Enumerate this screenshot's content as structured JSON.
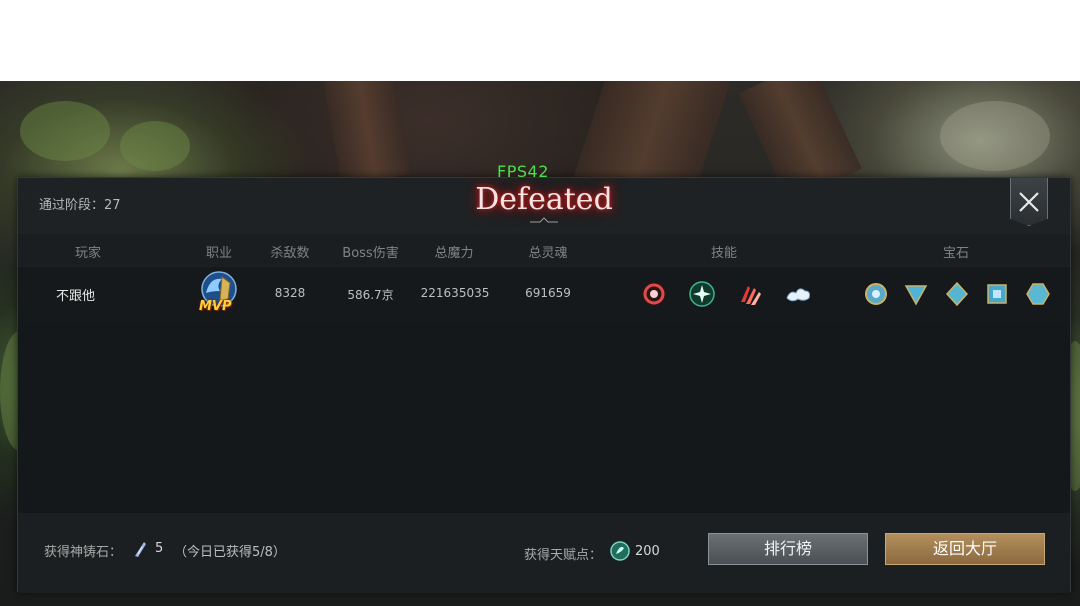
{
  "hud": {
    "fps": "FPS42"
  },
  "result": {
    "title": "Defeated",
    "stage_label": "通过阶段：27"
  },
  "table": {
    "headers": [
      "玩家",
      "职业",
      "杀敌数",
      "Boss伤害",
      "总魔力",
      "总灵魂",
      "技能",
      "宝石"
    ],
    "rows": [
      {
        "player": "不跟他",
        "class_badge": "MVP",
        "kills": "8328",
        "boss_damage": "586.7京",
        "total_mana": "221635035",
        "total_soul": "691659",
        "skills": [
          "red-ring-skill-icon",
          "green-star-skill-icon",
          "red-claw-skill-icon",
          "white-cloud-skill-icon"
        ],
        "gems": [
          "round-gem-icon",
          "triangle-gem-icon",
          "diamond-gem-icon",
          "square-gem-icon",
          "hexagon-gem-icon"
        ]
      }
    ]
  },
  "footer": {
    "forge_stone_label": "获得神铸石：",
    "forge_stone_value": "5",
    "forge_stone_daily": "（今日已获得5/8）",
    "talent_label": "获得天赋点：",
    "talent_value": "200",
    "rank_button": "排行榜",
    "lobby_button": "返回大厅"
  },
  "colors": {
    "fps": "#4be04b",
    "title_glow": "#d02020",
    "lobby_button": "#a5824f",
    "rank_button": "#5c6165"
  }
}
